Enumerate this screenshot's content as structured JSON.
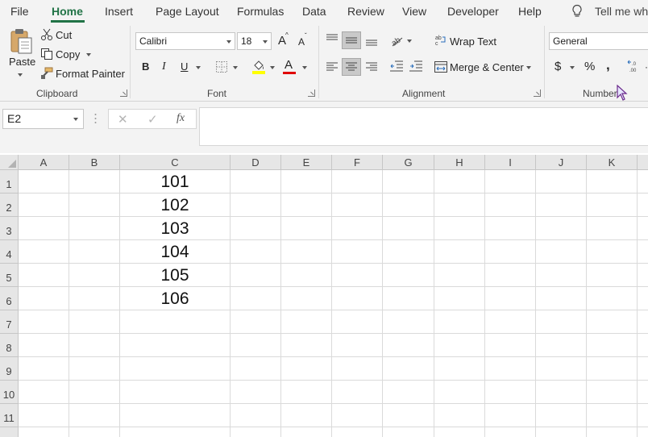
{
  "menu": {
    "tabs": [
      "File",
      "Home",
      "Insert",
      "Page Layout",
      "Formulas",
      "Data",
      "Review",
      "View",
      "Developer",
      "Help"
    ],
    "tell_me": "Tell me wha"
  },
  "ribbon": {
    "clipboard": {
      "paste": "Paste",
      "cut": "Cut",
      "copy": "Copy",
      "format_painter": "Format Painter",
      "label": "Clipboard"
    },
    "font": {
      "name": "Calibri",
      "size": "18",
      "bold": "B",
      "italic": "I",
      "underline": "U",
      "font_color_letter": "A",
      "grow_letter": "A",
      "shrink_letter": "A",
      "label": "Font"
    },
    "alignment": {
      "wrap_text": "Wrap Text",
      "merge_center": "Merge & Center",
      "label": "Alignment"
    },
    "number": {
      "format": "General",
      "currency": "$",
      "percent": "%",
      "comma": ",",
      "label": "Number"
    }
  },
  "formula_bar": {
    "name_box": "E2",
    "cancel": "✕",
    "enter": "✓",
    "fx": "fx",
    "content": ""
  },
  "sheet": {
    "columns": [
      "A",
      "B",
      "C",
      "D",
      "E",
      "F",
      "G",
      "H",
      "I",
      "J",
      "K"
    ],
    "rows": [
      "1",
      "2",
      "3",
      "4",
      "5",
      "6",
      "7",
      "8",
      "9",
      "10",
      "11"
    ],
    "column_c_values": [
      "101",
      "102",
      "103",
      "104",
      "105",
      "106"
    ]
  },
  "colors": {
    "accent": "#217346",
    "highlight_yellow": "#ffff00",
    "font_red": "#e00000"
  }
}
